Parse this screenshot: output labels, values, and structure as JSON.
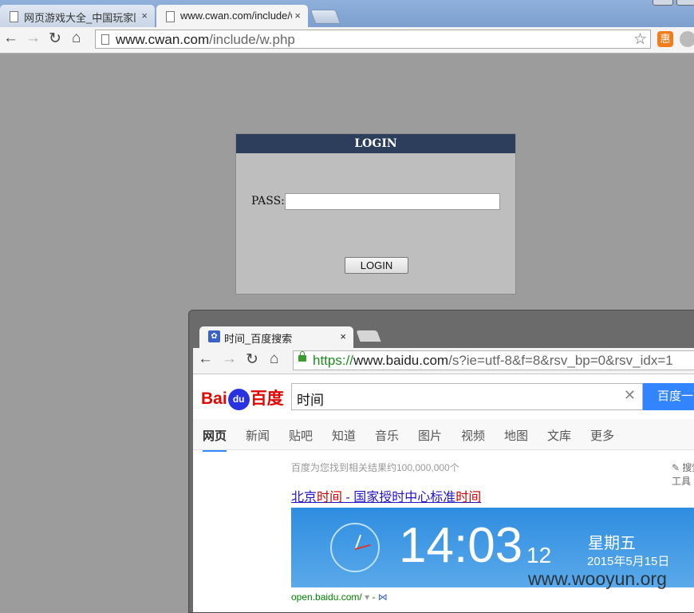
{
  "browser": {
    "tabs": [
      {
        "title": "网页游戏大全_中国玩家网",
        "close": "×"
      },
      {
        "title": "www.cwan.com/include/w.php",
        "close": "×"
      }
    ],
    "url_host": "www.cwan.com",
    "url_path": "/include/w.php",
    "ext_label": "惠"
  },
  "login": {
    "title": "LOGIN",
    "pass_label": "PASS:",
    "pass_value": "",
    "button_label": "LOGIN"
  },
  "inner_browser": {
    "tab_title": "时间_百度搜索",
    "tab_close": "×",
    "url_scheme": "https://",
    "url_host": "www.baidu.com",
    "url_rest": "/s?ie=utf-8&f=8&rsv_bp=0&rsv_idx=1"
  },
  "baidu": {
    "logo_left": "Bai",
    "logo_mid": "du",
    "logo_right": "百度",
    "query": "时间",
    "search_button": "百度一下",
    "tabs": [
      "网页",
      "新闻",
      "贴吧",
      "知道",
      "音乐",
      "图片",
      "视频",
      "地图",
      "文库",
      "更多"
    ],
    "result_count": "百度为您找到相关结果约100,000,000个",
    "tools": "搜索工具",
    "result_title_1": "北京",
    "result_title_hl_1": "时间",
    "result_title_2": " - 国家授时中心标准",
    "result_title_hl_2": "时间",
    "clock_time": "14:03",
    "clock_seconds": "12",
    "weekday": "星期五",
    "date": "2015年5月15日",
    "source": "open.baidu.com/"
  },
  "watermark": "www.wooyun.org"
}
